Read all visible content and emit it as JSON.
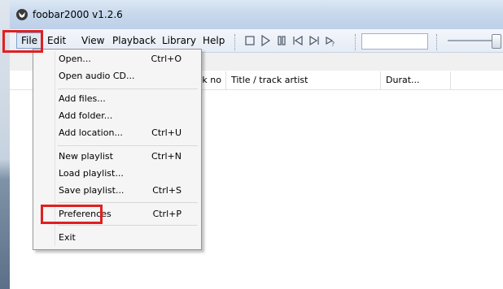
{
  "window": {
    "title": "foobar2000 v1.2.6"
  },
  "menubar": {
    "items": [
      {
        "label": "File"
      },
      {
        "label": "Edit"
      },
      {
        "label": "View"
      },
      {
        "label": "Playback"
      },
      {
        "label": "Library"
      },
      {
        "label": "Help"
      }
    ]
  },
  "toolbar": {
    "buttons": [
      "stop-icon",
      "play-icon",
      "pause-icon",
      "previous-icon",
      "next-icon",
      "random-icon"
    ]
  },
  "playlist": {
    "columns": [
      "Track no",
      "Title / track artist",
      "Durat..."
    ]
  },
  "file_menu": {
    "items": [
      {
        "label": "Open...",
        "shortcut": "Ctrl+O"
      },
      {
        "label": "Open audio CD...",
        "shortcut": ""
      },
      {
        "label": "Add files...",
        "shortcut": ""
      },
      {
        "label": "Add folder...",
        "shortcut": ""
      },
      {
        "label": "Add location...",
        "shortcut": "Ctrl+U"
      },
      {
        "label": "New playlist",
        "shortcut": "Ctrl+N"
      },
      {
        "label": "Load playlist...",
        "shortcut": ""
      },
      {
        "label": "Save playlist...",
        "shortcut": "Ctrl+S"
      },
      {
        "label": "Preferences",
        "shortcut": "Ctrl+P"
      },
      {
        "label": "Exit",
        "shortcut": ""
      }
    ]
  },
  "colors": {
    "highlight": "#e02020",
    "titlebar": "#c7d8ec",
    "menu_bg": "#f5f5f5"
  }
}
